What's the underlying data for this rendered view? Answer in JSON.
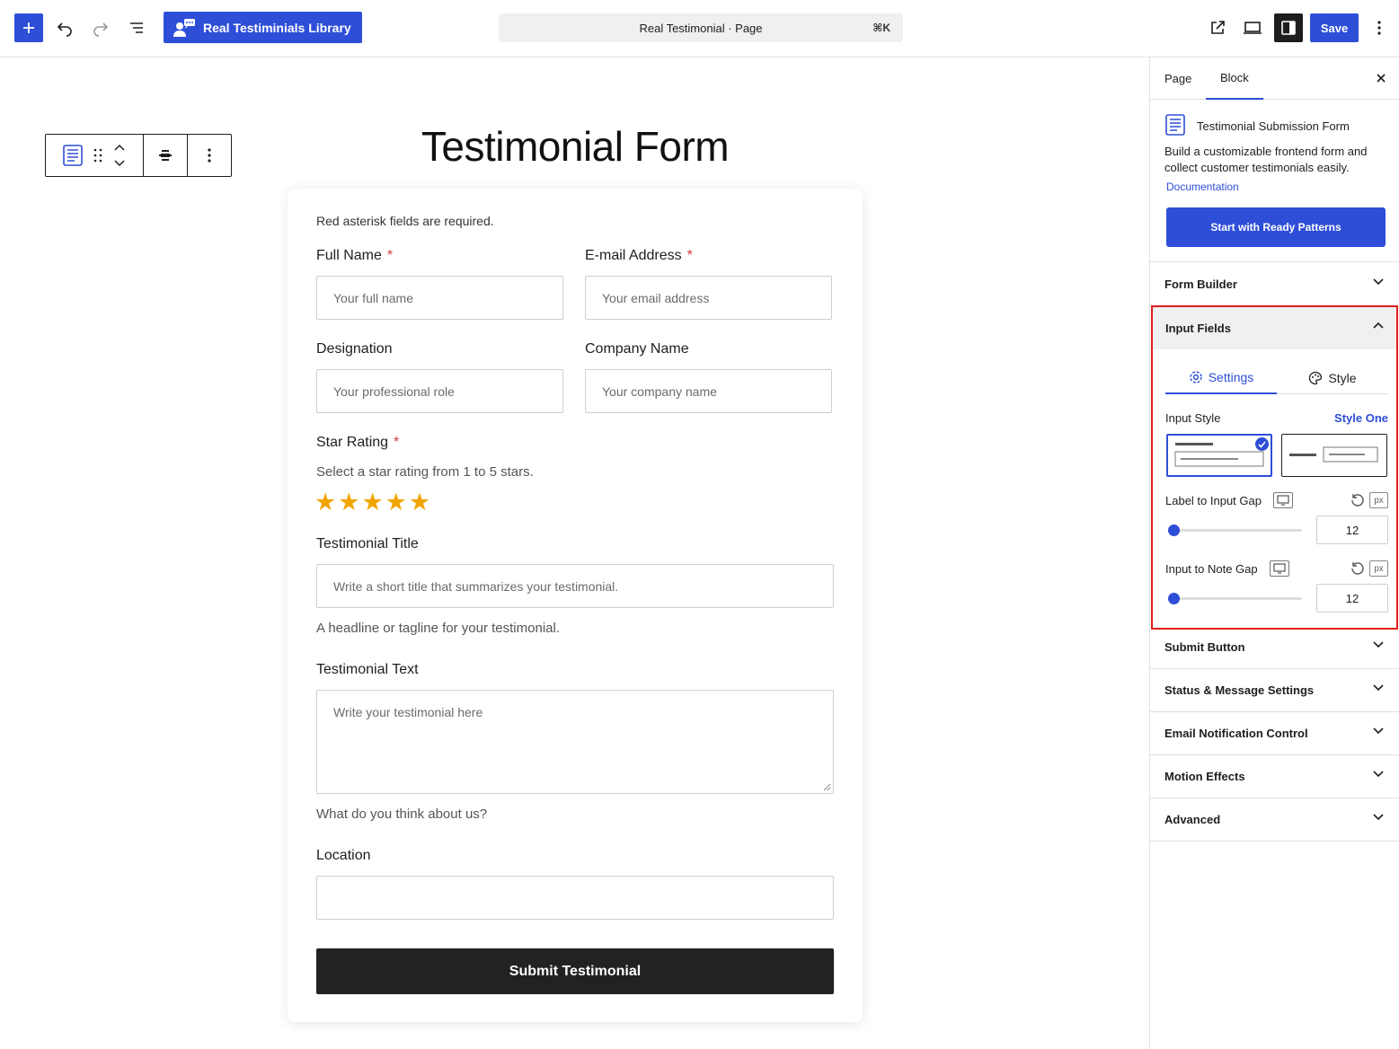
{
  "toolbar": {
    "library_label": "Real Testiminials Library",
    "command_title": "Real Testimonial · Page",
    "command_shortcut": "⌘K",
    "save_label": "Save"
  },
  "form": {
    "title": "Testimonial Form",
    "required_note": "Red asterisk fields are required.",
    "required_mark": "*",
    "full_name": {
      "label": "Full Name",
      "placeholder": "Your full name"
    },
    "email": {
      "label": "E-mail Address",
      "placeholder": "Your email address"
    },
    "designation": {
      "label": "Designation",
      "placeholder": "Your professional role"
    },
    "company": {
      "label": "Company Name",
      "placeholder": "Your company name"
    },
    "star_rating": {
      "label": "Star Rating",
      "help": "Select a star rating from 1 to 5 stars.",
      "stars": 5
    },
    "testimonial_title": {
      "label": "Testimonial Title",
      "placeholder": "Write a short title that summarizes your testimonial.",
      "help": "A headline or tagline for your testimonial."
    },
    "testimonial_text": {
      "label": "Testimonial Text",
      "placeholder": "Write your testimonial here",
      "help": "What do you think about us?"
    },
    "location": {
      "label": "Location",
      "placeholder": ""
    },
    "submit_label": "Submit Testimonial"
  },
  "sidebar": {
    "tabs": {
      "page": "Page",
      "block": "Block"
    },
    "block": {
      "title": "Testimonial Submission Form",
      "description": "Build a customizable frontend form and collect customer testimonials easily.",
      "doc_link": "Documentation",
      "ready_button": "Start with Ready Patterns"
    },
    "sections": {
      "form_builder": "Form Builder",
      "input_fields": "Input Fields",
      "submit_button": "Submit Button",
      "status_message": "Status & Message Settings",
      "email_notification": "Email Notification Control",
      "motion_effects": "Motion Effects",
      "advanced": "Advanced"
    },
    "input_fields": {
      "tab_settings": "Settings",
      "tab_style": "Style",
      "input_style_label": "Input Style",
      "input_style_value": "Style One",
      "label_gap_label": "Label to Input Gap",
      "label_gap_value": "12",
      "note_gap_label": "Input to Note Gap",
      "note_gap_value": "12",
      "unit": "px"
    }
  },
  "colors": {
    "accent": "#2e4ed8",
    "star": "#f0a500",
    "required": "#d63638",
    "highlight": "#e11d1d"
  }
}
